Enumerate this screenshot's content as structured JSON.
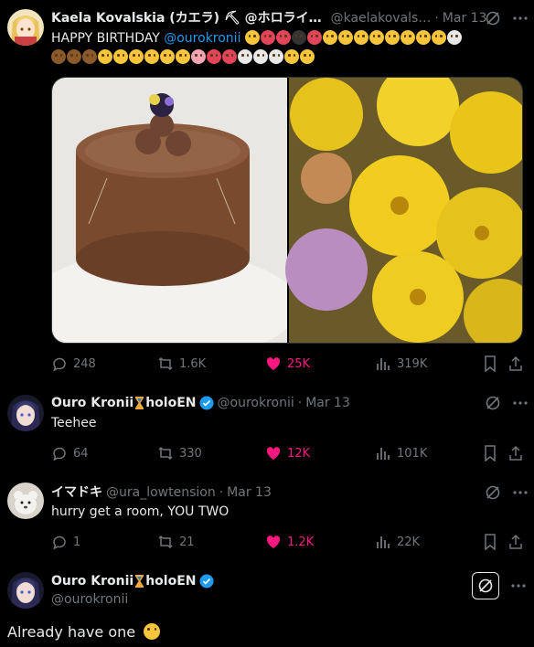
{
  "tweet1": {
    "display_name": "Kaela Kovalskia (カエラ) ⛏ @ホロライ…",
    "handle": "@kaelakovals…",
    "separator": "·",
    "time": "Mar 13",
    "text_prefix": "HAPPY BIRTHDAY ",
    "mention": "@ourokronii",
    "media_images": [
      "chocolate-cake-image",
      "yellow-flowers-image"
    ],
    "actions": {
      "replies": "248",
      "reposts": "1.6K",
      "likes": "25K",
      "views": "319K"
    }
  },
  "tweet2": {
    "display_name_part1": "Ouro Kronii",
    "display_name_part2": "holoEN",
    "handle": "@ourokronii",
    "separator": "·",
    "time": "Mar 13",
    "text": "Teehee",
    "actions": {
      "replies": "64",
      "reposts": "330",
      "likes": "12K",
      "views": "101K"
    }
  },
  "tweet3": {
    "display_name": "イマドキ",
    "handle": "@ura_lowtension",
    "separator": "·",
    "time": "Mar 13",
    "text": "hurry get a room, YOU TWO",
    "actions": {
      "replies": "1",
      "reposts": "21",
      "likes": "1.2K",
      "views": "22K"
    }
  },
  "tweet4": {
    "display_name_part1": "Ouro Kronii",
    "display_name_part2": "holoEN",
    "handle": "@ourokronii",
    "text": "Already have one"
  },
  "colors": {
    "background": "#000000",
    "text": "#e7e9ea",
    "muted": "#71767b",
    "like": "#f91880",
    "link": "#1d9bf0",
    "verified": "#1d9bf0"
  }
}
